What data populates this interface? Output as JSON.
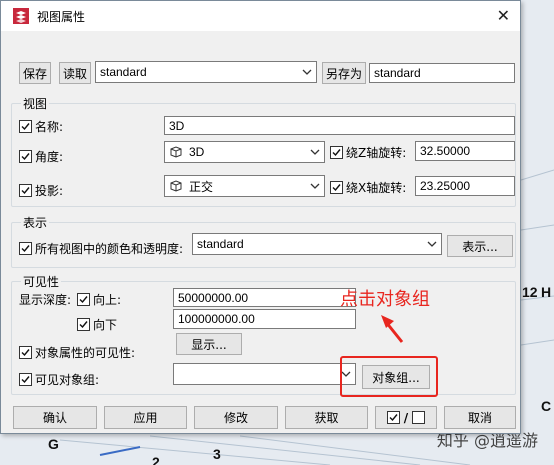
{
  "dialog": {
    "title": "视图属性",
    "top": {
      "save_label": "保存",
      "read_label": "读取",
      "preset_value": "standard",
      "save_as_label": "另存为",
      "save_as_value": "standard"
    },
    "view_group": {
      "title": "视图",
      "name_label": "名称:",
      "name_value": "3D",
      "angle_label": "角度:",
      "angle_value": "3D",
      "z_rotation_label": "绕Z轴旋转:",
      "z_rotation_value": "32.50000",
      "projection_label": "投影:",
      "projection_value": "正交",
      "x_rotation_label": "绕X轴旋转:",
      "x_rotation_value": "23.25000"
    },
    "display_group": {
      "title": "表示",
      "color_label": "所有视图中的颜色和透明度:",
      "color_value": "standard",
      "display_button": "表示..."
    },
    "visibility_group": {
      "title": "可见性",
      "depth_label": "显示深度:",
      "up_label": "向上:",
      "up_value": "50000000.00",
      "down_label": "向下",
      "down_value": "100000000.00",
      "object_props_label": "对象属性的可见性:",
      "show_button": "显示...",
      "visible_groups_label": "可见对象组:",
      "visible_groups_value": "",
      "object_group_button": "对象组..."
    },
    "bottom": {
      "ok": "确认",
      "apply": "应用",
      "modify": "修改",
      "get": "获取",
      "toggle": "/",
      "cancel": "取消"
    }
  },
  "annotation": {
    "text": "点击对象组",
    "color": "#e8261f"
  },
  "background": {
    "labels": [
      "G",
      "3",
      "2",
      "12",
      "H",
      "C"
    ]
  },
  "watermark": "知乎 @逍遥游"
}
